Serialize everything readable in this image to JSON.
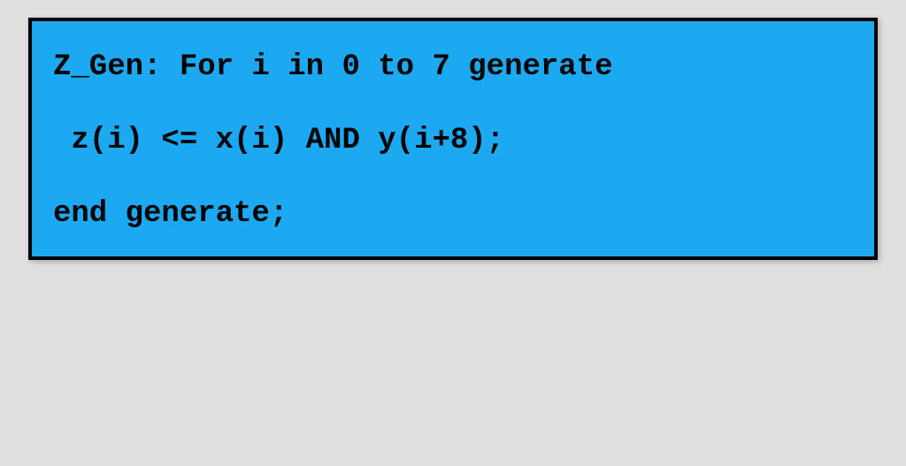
{
  "code": {
    "line1": "Z_Gen: For i in 0 to 7 generate",
    "line2": " z(i) <= x(i) AND y(i+8);",
    "line3": "end generate;"
  }
}
